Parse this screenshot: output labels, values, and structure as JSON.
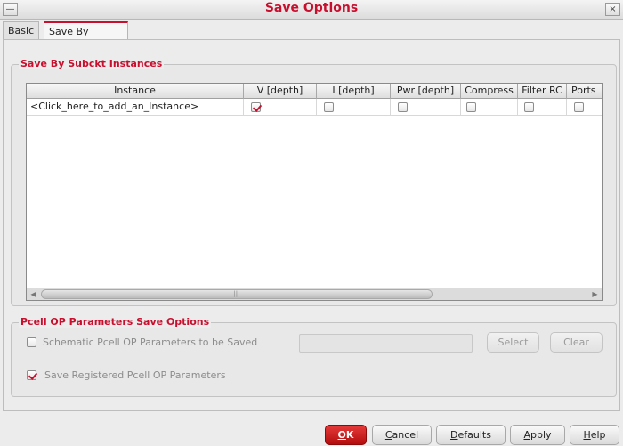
{
  "window": {
    "title": "Save Options",
    "menu_glyph": "—",
    "close_glyph": "×"
  },
  "tabs": [
    {
      "label": "Basic",
      "active": false
    },
    {
      "label": "Save By Subckt",
      "active": true
    }
  ],
  "instances_group": {
    "title": "Save By Subckt Instances",
    "columns": [
      "Instance",
      "V [depth]",
      "I [depth]",
      "Pwr [depth]",
      "Compress",
      "Filter RC",
      "Ports"
    ],
    "rows": [
      {
        "instance": "<Click_here_to_add_an_Instance>",
        "v": true,
        "i": false,
        "pwr": false,
        "compress": false,
        "filter_rc": false,
        "ports": false
      }
    ],
    "scroll_left_glyph": "◀",
    "scroll_right_glyph": "▶",
    "scroll_grip": "|||"
  },
  "pcell_group": {
    "title": "Pcell OP Parameters Save Options",
    "schematic_label": "Schematic Pcell OP Parameters to be Saved",
    "schematic_checked": false,
    "registered_label": "Save Registered Pcell OP Parameters",
    "registered_checked": true,
    "select_label": "Select",
    "clear_label": "Clear"
  },
  "footer": {
    "ok": {
      "mnemonic": "O",
      "rest": "K"
    },
    "cancel": {
      "mnemonic": "C",
      "rest": "ancel"
    },
    "defaults": {
      "mnemonic": "D",
      "rest": "efaults"
    },
    "apply": {
      "mnemonic": "A",
      "rest": "pply"
    },
    "help": {
      "mnemonic": "H",
      "rest": "elp"
    }
  },
  "colors": {
    "accent": "#c8102e",
    "background": "#ececec"
  }
}
